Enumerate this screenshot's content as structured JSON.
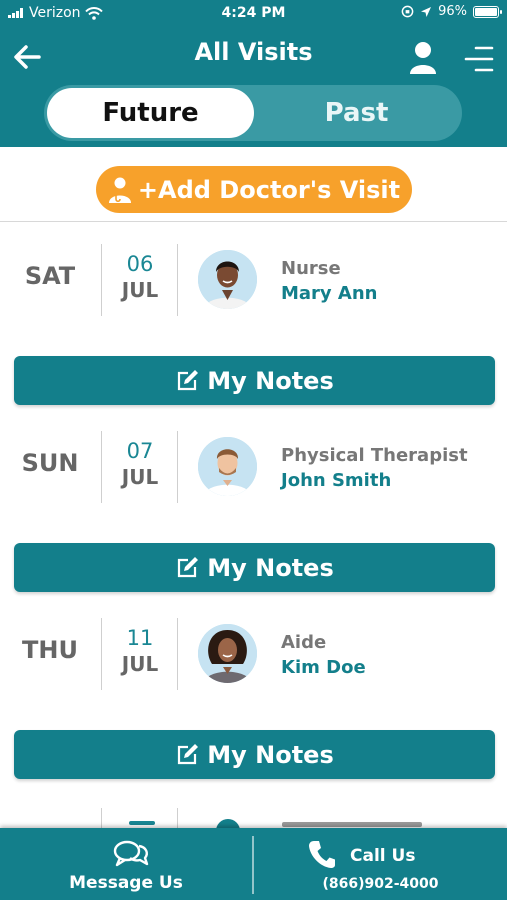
{
  "status_bar": {
    "carrier": "Verizon",
    "time": "4:24 PM",
    "battery": "96%"
  },
  "header": {
    "title": "All Visits",
    "back_icon": "arrow-left-icon",
    "profile_icon": "person-icon",
    "menu_icon": "menu-icon"
  },
  "tabs": {
    "future": "Future",
    "past": "Past",
    "selected": "Future"
  },
  "add_button": {
    "label": "+Add Doctor's Visit",
    "icon": "doctor-icon"
  },
  "visits": [
    {
      "day": "SAT",
      "date": "06",
      "month": "JUL",
      "role": "Nurse",
      "name": "Mary Ann",
      "notes_label": "My Notes"
    },
    {
      "day": "SUN",
      "date": "07",
      "month": "JUL",
      "role": "Physical Therapist",
      "name": "John Smith",
      "notes_label": "My Notes"
    },
    {
      "day": "THU",
      "date": "11",
      "month": "JUL",
      "role": "Aide",
      "name": "Kim Doe",
      "notes_label": "My Notes"
    }
  ],
  "bottom_bar": {
    "message_label": "Message Us",
    "call_label": "Call Us",
    "phone": "(866)902-4000"
  },
  "colors": {
    "primary": "#137f8b",
    "accent": "#f7a12b",
    "segment_bg": "#3a9aa4"
  }
}
